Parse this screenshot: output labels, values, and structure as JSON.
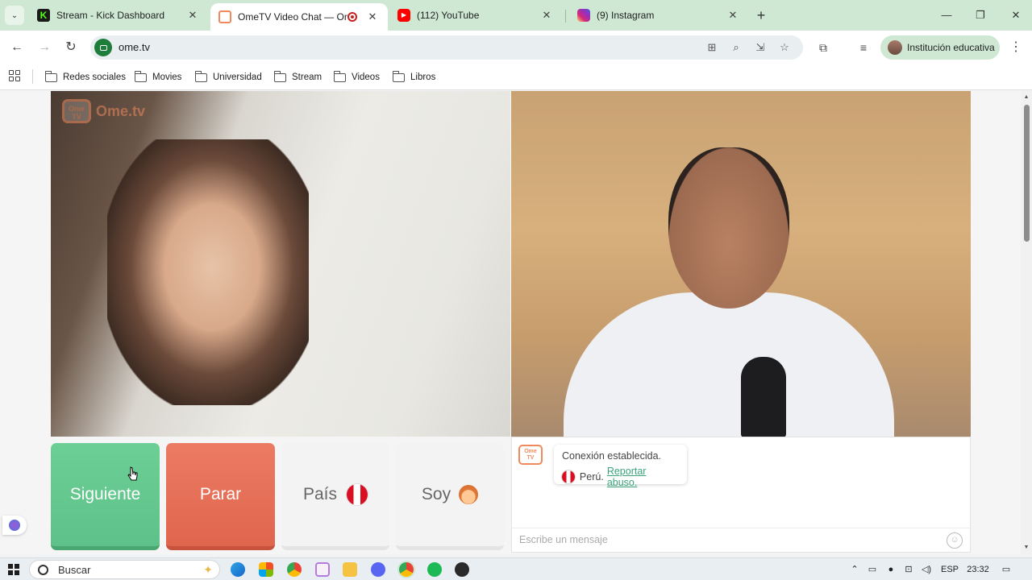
{
  "tabs": [
    {
      "title": "Stream - Kick Dashboard",
      "favicon": "kick-icon",
      "color": "#53fc18"
    },
    {
      "title": "OmeTV Video Chat — Ome",
      "favicon": "ometv-icon",
      "active": true,
      "recording": true
    },
    {
      "title": "(112) YouTube",
      "favicon": "youtube-icon",
      "color": "#ff0000"
    },
    {
      "title": "(9) Instagram",
      "favicon": "instagram-icon"
    }
  ],
  "address_bar": {
    "url": "ome.tv"
  },
  "profile": {
    "label": "Institución educativa"
  },
  "bookmarks": [
    "Redes sociales",
    "Movies",
    "Universidad",
    "Stream",
    "Videos",
    "Libros"
  ],
  "video": {
    "watermark": "Ome.tv",
    "logo_text": "Ome TV"
  },
  "controls": {
    "next_label": "Siguiente",
    "stop_label": "Parar",
    "country_label": "País",
    "gender_label": "Soy"
  },
  "chat": {
    "status": "Conexión establecida.",
    "country": "Perú.",
    "report_link": "Reportar abuso.",
    "input_placeholder": "Escribe un mensaje"
  },
  "taskbar": {
    "search_placeholder": "Buscar",
    "language": "ESP",
    "time": "23:32"
  },
  "colors": {
    "next_button": "#5ec189",
    "stop_button": "#e0654e",
    "brand": "#f08a5d",
    "tab_strip": "#cfe8d3"
  }
}
